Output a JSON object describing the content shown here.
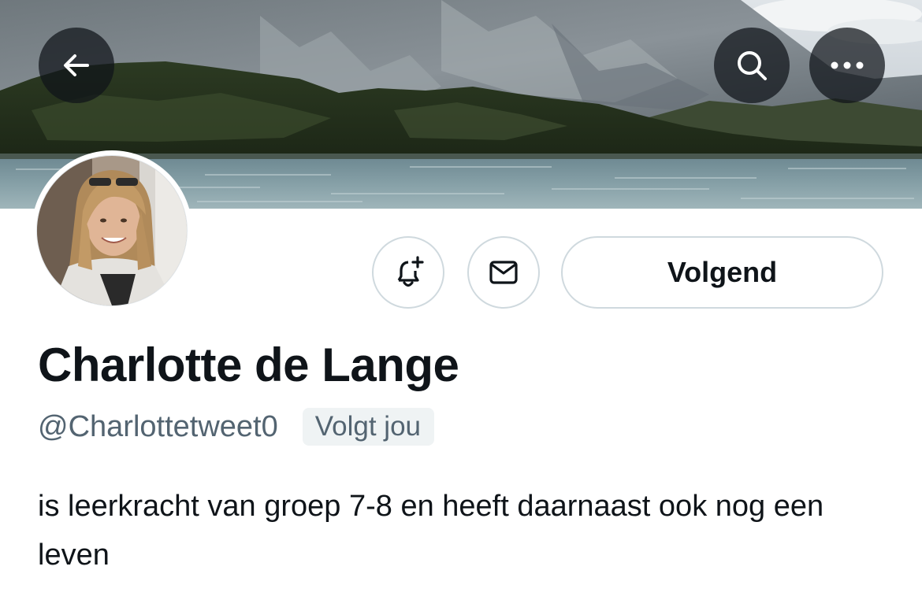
{
  "header": {
    "back_icon": "arrow-left-icon",
    "search_icon": "search-icon",
    "more_icon": "more-horizontal-icon"
  },
  "actions": {
    "notify_icon": "bell-plus-icon",
    "message_icon": "envelope-icon",
    "follow_label": "Volgend"
  },
  "profile": {
    "display_name": "Charlotte de Lange",
    "handle": "@Charlottetweet0",
    "follows_you_badge": "Volgt jou",
    "bio": "is leerkracht van groep 7-8 en heeft daarnaast ook nog een leven"
  },
  "colors": {
    "text_primary": "#0f1419",
    "text_secondary": "#536471",
    "border": "#cfd9de",
    "badge_bg": "#eff3f4"
  }
}
